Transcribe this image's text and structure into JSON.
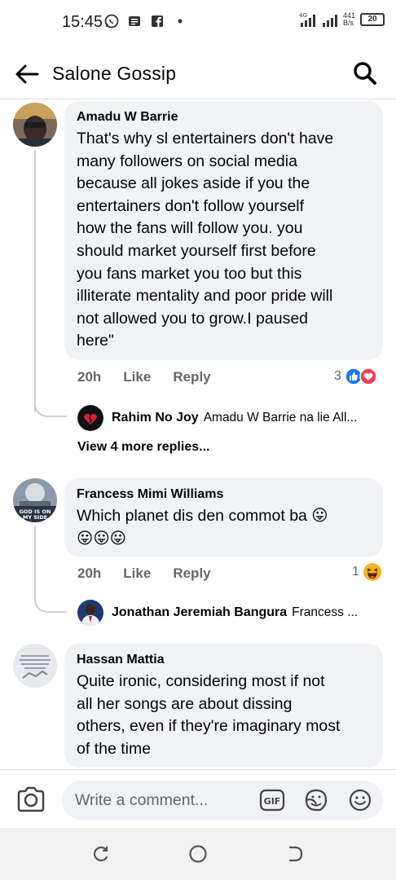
{
  "status_bar": {
    "time": "15:45",
    "net_speed_value": "441",
    "net_speed_unit": "B/s",
    "network_type": "4G",
    "battery": "20"
  },
  "header": {
    "title": "Salone Gossip"
  },
  "comments": [
    {
      "author": "Amadu W Barrie",
      "text_lines": [
        "That's why sl entertainers don't have",
        "many followers on social media",
        "because all jokes aside if you the",
        "entertainers don't follow yourself",
        "how the fans will follow you. you",
        "should market yourself first before",
        "you fans market you too but this",
        "illiterate mentality and poor pride will",
        "not allowed you to grow.I paused",
        "here\""
      ],
      "time": "20h",
      "like_label": "Like",
      "reply_label": "Reply",
      "reaction_count": "3",
      "reply_preview": {
        "author": "Rahim No Joy",
        "text": "Amadu W Barrie na lie All..."
      },
      "more_replies": "View 4 more replies..."
    },
    {
      "author": "Francess Mimi Williams",
      "text_lines": [
        "Which planet dis den commot ba 😛",
        "😛😛😛"
      ],
      "avatar_text": "GOD IS ON MY SIDE",
      "time": "20h",
      "like_label": "Like",
      "reply_label": "Reply",
      "reaction_count": "1",
      "reply_preview": {
        "author": "Jonathan Jeremiah Bangura",
        "text": "Francess ..."
      }
    },
    {
      "author": "Hassan Mattia",
      "text_lines": [
        "Quite ironic, considering most if not",
        "all her songs are about dissing",
        "others, even if they're imaginary most",
        "of the time"
      ]
    }
  ],
  "composer": {
    "placeholder": "Write a comment...",
    "gif_label": "GIF"
  },
  "colors": {
    "bubble": "#f0f2f5",
    "like_blue": "#1877f2",
    "love_red": "#f33e58",
    "haha_yellow": "#f7b125",
    "secondary_text": "#65676b"
  }
}
